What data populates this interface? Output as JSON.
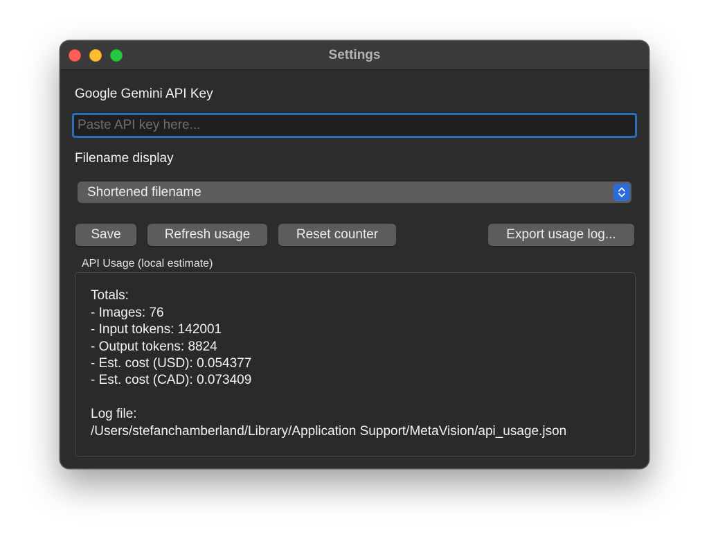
{
  "window": {
    "title": "Settings"
  },
  "api_key": {
    "label": "Google Gemini API Key",
    "value": "",
    "placeholder": "Paste API key here..."
  },
  "filename_display": {
    "label": "Filename display",
    "selected": "Shortened filename"
  },
  "buttons": {
    "save": "Save",
    "refresh": "Refresh usage",
    "reset": "Reset counter",
    "export": "Export usage log..."
  },
  "usage": {
    "group_label": "API Usage (local estimate)",
    "totals_heading": "Totals:",
    "images": "- Images: 76",
    "input_tokens": "- Input tokens: 142001",
    "output_tokens": "- Output tokens: 8824",
    "cost_usd": "- Est. cost (USD): 0.054377",
    "cost_cad": "- Est. cost (CAD): 0.073409",
    "log_heading": "Log file:",
    "log_path": "/Users/stefanchamberland/Library/Application Support/MetaVision/api_usage.json"
  },
  "colors": {
    "window_bg": "#2c2c2c",
    "focus_ring": "#2770b8",
    "accent": "#2d6bd8",
    "traffic_close": "#ff5f57",
    "traffic_minimize": "#febc2e",
    "traffic_zoom": "#28c840"
  },
  "icons": {
    "select_arrows": "chevron-up-down-icon"
  }
}
